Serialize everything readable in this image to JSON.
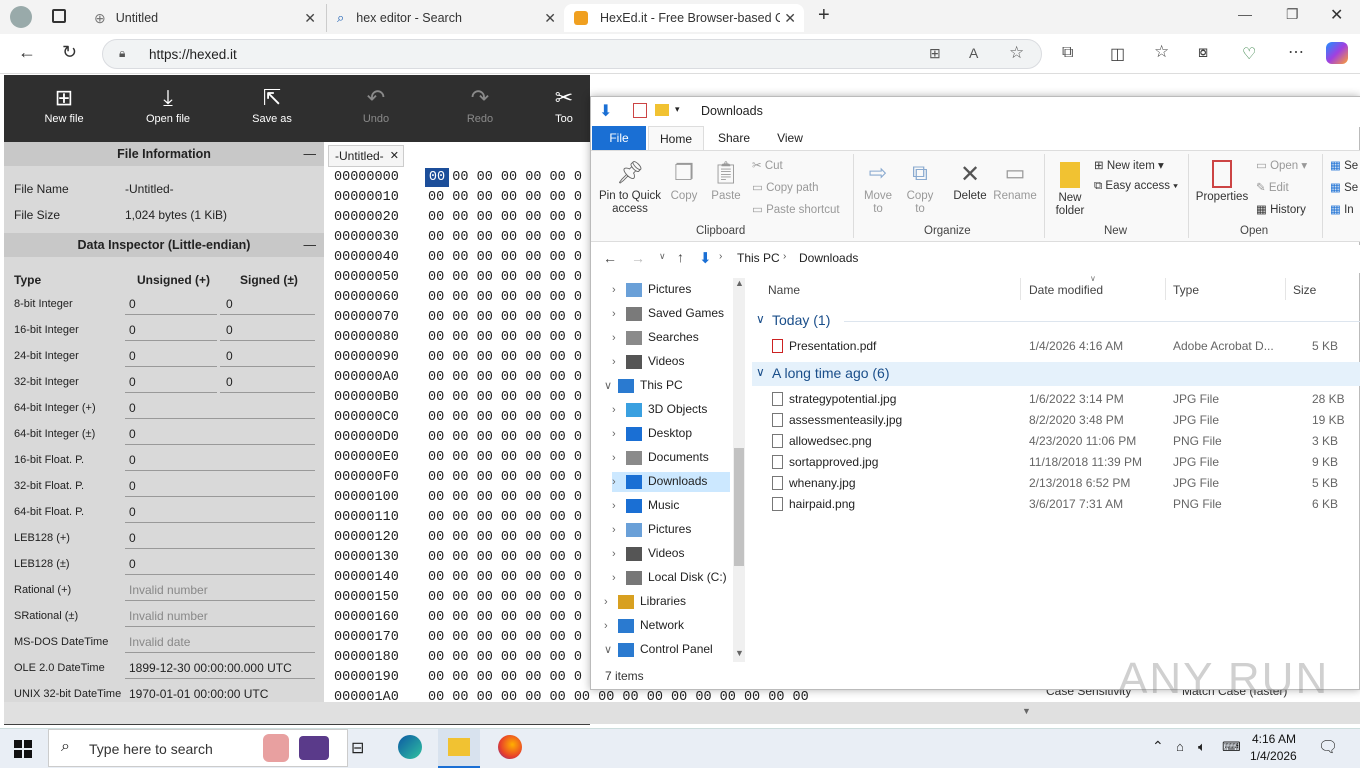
{
  "browser": {
    "tabs": [
      {
        "label": "Untitled"
      },
      {
        "label": "hex editor - Search"
      },
      {
        "label": "HexEd.it - Free Browser-based On"
      }
    ],
    "url": "https://hexed.it"
  },
  "hexed": {
    "toolbar": {
      "new_file": "New file",
      "open_file": "Open file",
      "save_as": "Save as",
      "undo": "Undo",
      "redo": "Redo",
      "tools": "Too"
    },
    "file_info": {
      "title": "File Information",
      "name_label": "File Name",
      "name_value": "-Untitled-",
      "size_label": "File Size",
      "size_value": "1,024 bytes (1 KiB)"
    },
    "inspector": {
      "title": "Data Inspector (Little-endian)",
      "col_type": "Type",
      "col_unsigned": "Unsigned (+)",
      "col_signed": "Signed (±)",
      "rows": [
        {
          "label": "8-bit Integer",
          "u": "0",
          "s": "0"
        },
        {
          "label": "16-bit Integer",
          "u": "0",
          "s": "0"
        },
        {
          "label": "24-bit Integer",
          "u": "0",
          "s": "0"
        },
        {
          "label": "32-bit Integer",
          "u": "0",
          "s": "0"
        },
        {
          "label": "64-bit Integer (+)",
          "v": "0"
        },
        {
          "label": "64-bit Integer (±)",
          "v": "0"
        },
        {
          "label": "16-bit Float. P.",
          "v": "0"
        },
        {
          "label": "32-bit Float. P.",
          "v": "0"
        },
        {
          "label": "64-bit Float. P.",
          "v": "0"
        },
        {
          "label": "LEB128 (+)",
          "v": "0"
        },
        {
          "label": "LEB128 (±)",
          "v": "0"
        },
        {
          "label": "Rational (+)",
          "v": "Invalid number"
        },
        {
          "label": "SRational (±)",
          "v": "Invalid number"
        },
        {
          "label": "MS-DOS DateTime",
          "v": "Invalid date"
        },
        {
          "label": "OLE 2.0 DateTime",
          "v": "1899-12-30 00:00:00.000 UTC"
        },
        {
          "label": "UNIX 32-bit DateTime",
          "v": "1970-01-01 00:00:00 UTC"
        }
      ]
    },
    "tab_label": "-Untitled-",
    "offsets": [
      "00000000",
      "00000010",
      "00000020",
      "00000030",
      "00000040",
      "00000050",
      "00000060",
      "00000070",
      "00000080",
      "00000090",
      "000000A0",
      "000000B0",
      "000000C0",
      "000000D0",
      "000000E0",
      "000000F0",
      "00000100",
      "00000110",
      "00000120",
      "00000130",
      "00000140",
      "00000150",
      "00000160",
      "00000170",
      "00000180",
      "00000190",
      "000001A0"
    ],
    "bytes_row": "00 00 00 00 00 00 0",
    "selected_byte": "00",
    "last_row_bytes": "00 00 00 00 00 00 00 00 00 00 00 00 00 00 00 00",
    "status": {
      "case": "Case Sensitivity",
      "match": "Match Case (faster)"
    }
  },
  "explorer": {
    "title": "Downloads",
    "ribbon_tabs": [
      "File",
      "Home",
      "Share",
      "View"
    ],
    "clipboard": {
      "pin": "Pin to Quick access",
      "copy": "Copy",
      "paste": "Paste",
      "cut": "Cut",
      "copy_path": "Copy path",
      "paste_shortcut": "Paste shortcut",
      "label": "Clipboard"
    },
    "organize": {
      "move": "Move to",
      "copy": "Copy to",
      "delete": "Delete",
      "rename": "Rename",
      "label": "Organize"
    },
    "new": {
      "folder": "New folder",
      "item": "New item",
      "easy": "Easy access",
      "label": "New"
    },
    "open": {
      "properties": "Properties",
      "open": "Open",
      "edit": "Edit",
      "history": "History",
      "label": "Open"
    },
    "select": {
      "a": "Se",
      "b": "Se",
      "c": "In"
    },
    "breadcrumb": [
      "This PC",
      "Downloads"
    ],
    "tree": [
      {
        "label": "Pictures",
        "lvl": 1
      },
      {
        "label": "Saved Games",
        "lvl": 1
      },
      {
        "label": "Searches",
        "lvl": 1
      },
      {
        "label": "Videos",
        "lvl": 1
      },
      {
        "label": "This PC",
        "lvl": 0
      },
      {
        "label": "3D Objects",
        "lvl": 1
      },
      {
        "label": "Desktop",
        "lvl": 1
      },
      {
        "label": "Documents",
        "lvl": 1
      },
      {
        "label": "Downloads",
        "lvl": 1
      },
      {
        "label": "Music",
        "lvl": 1
      },
      {
        "label": "Pictures",
        "lvl": 1
      },
      {
        "label": "Videos",
        "lvl": 1
      },
      {
        "label": "Local Disk (C:)",
        "lvl": 1
      },
      {
        "label": "Libraries",
        "lvl": 0
      },
      {
        "label": "Network",
        "lvl": 0
      },
      {
        "label": "Control Panel",
        "lvl": 0
      }
    ],
    "columns": {
      "name": "Name",
      "date": "Date modified",
      "type": "Type",
      "size": "Size"
    },
    "group_today": "Today (1)",
    "group_old": "A long time ago (6)",
    "files": [
      {
        "name": "Presentation.pdf",
        "date": "1/4/2026 4:16 AM",
        "type": "Adobe Acrobat D...",
        "size": "5 KB"
      },
      {
        "name": "strategypotential.jpg",
        "date": "1/6/2022 3:14 PM",
        "type": "JPG File",
        "size": "28 KB"
      },
      {
        "name": "assessmenteasily.jpg",
        "date": "8/2/2020 3:48 PM",
        "type": "JPG File",
        "size": "19 KB"
      },
      {
        "name": "allowedsec.png",
        "date": "4/23/2020 11:06 PM",
        "type": "PNG File",
        "size": "3 KB"
      },
      {
        "name": "sortapproved.jpg",
        "date": "11/18/2018 11:39 PM",
        "type": "JPG File",
        "size": "9 KB"
      },
      {
        "name": "whenany.jpg",
        "date": "2/13/2018 6:52 PM",
        "type": "JPG File",
        "size": "5 KB"
      },
      {
        "name": "hairpaid.png",
        "date": "3/6/2017 7:31 AM",
        "type": "PNG File",
        "size": "6 KB"
      }
    ],
    "item_count": "7 items"
  },
  "taskbar": {
    "search_placeholder": "Type here to search",
    "time": "4:16 AM",
    "date": "1/4/2026"
  },
  "watermark": "ANY RUN"
}
